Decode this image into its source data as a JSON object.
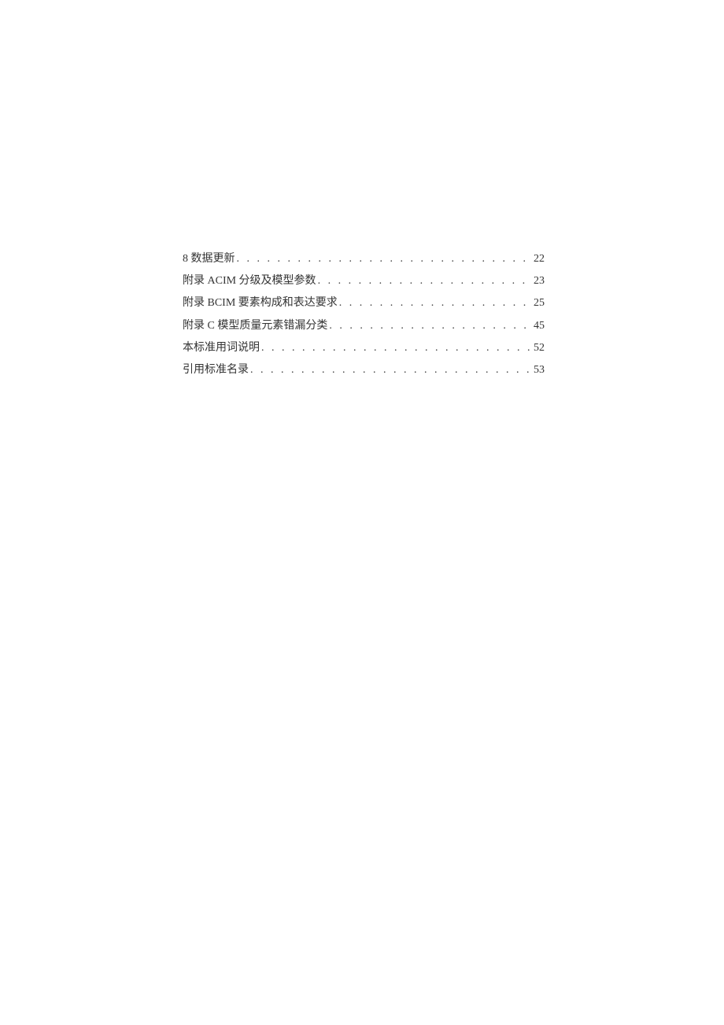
{
  "toc": {
    "entries": [
      {
        "title": "8 数据更新",
        "page": "22"
      },
      {
        "title": "附录 ACIM 分级及模型参数",
        "page": "23"
      },
      {
        "title": "附录 BCIM 要素构成和表达要求",
        "page": "25"
      },
      {
        "title": "附录 C 模型质量元素错漏分类",
        "page": "45"
      },
      {
        "title": "本标准用词说明",
        "page": "52"
      },
      {
        "title": "引用标准名录",
        "page": "53"
      }
    ]
  }
}
